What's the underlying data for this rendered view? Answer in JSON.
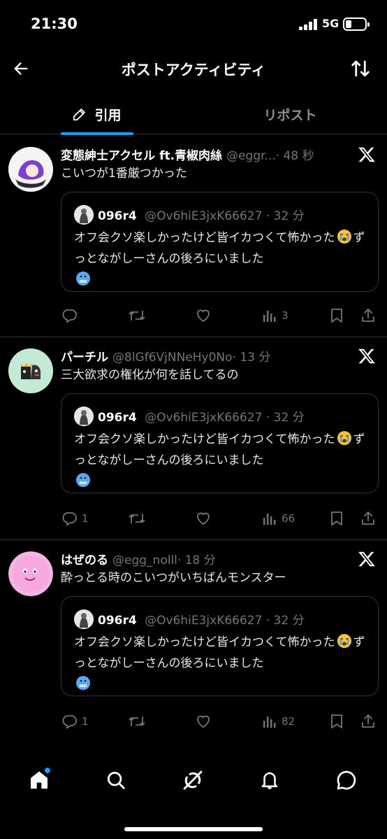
{
  "status_bar": {
    "time": "21:30",
    "network": "5G"
  },
  "header": {
    "title": "ポストアクティビティ"
  },
  "tabs": [
    {
      "label": "引用",
      "active": true
    },
    {
      "label": "リポスト",
      "active": false
    }
  ],
  "posts": [
    {
      "name": "変態紳士アクセル ft.青椒肉絲",
      "handle": "@eggr...",
      "time": "· 48 秒",
      "text": "こいつが1番厳つかった",
      "quote": {
        "name": "096r4",
        "handle": "@Ov6hiE3jxK66627 · 32 分",
        "text_a": "オフ会クソ楽しかったけど皆イカつくて怖かった",
        "text_b": "ずっとながしーさんの後ろにいました"
      },
      "actions": {
        "replies": "",
        "reposts": "",
        "likes": "",
        "views": "3"
      }
    },
    {
      "name": "パーチル",
      "handle": "@8lGf6VjNNeHy0No",
      "time": "· 13 分",
      "text": "三大欲求の権化が何を話してるの",
      "quote": {
        "name": "096r4",
        "handle": "@Ov6hiE3jxK66627 · 32 分",
        "text_a": "オフ会クソ楽しかったけど皆イカつくて怖かった",
        "text_b": "ずっとながしーさんの後ろにいました"
      },
      "actions": {
        "replies": "1",
        "reposts": "",
        "likes": "",
        "views": "66"
      }
    },
    {
      "name": "はぜのる",
      "handle": "@egg_nolll",
      "time": "· 18 分",
      "text": "酔っとる時のこいつがいちばんモンスター",
      "quote": {
        "name": "096r4",
        "handle": "@Ov6hiE3jxK66627 · 32 分",
        "text_a": "オフ会クソ楽しかったけど皆イカつくて怖かった",
        "text_b": "ずっとながしーさんの後ろにいました"
      },
      "actions": {
        "replies": "1",
        "reposts": "",
        "likes": "",
        "views": "82"
      }
    }
  ],
  "colors": {
    "accent": "#1d9bf0",
    "muted": "#71767b",
    "divider": "#2f3336",
    "background": "#000000"
  },
  "icons": [
    "back-arrow-icon",
    "sort-icon",
    "pen-icon",
    "x-logo-icon",
    "reply-icon",
    "repost-icon",
    "like-icon",
    "views-icon",
    "bookmark-icon",
    "share-icon",
    "home-icon",
    "search-icon",
    "grok-icon",
    "bell-icon",
    "messages-icon"
  ]
}
